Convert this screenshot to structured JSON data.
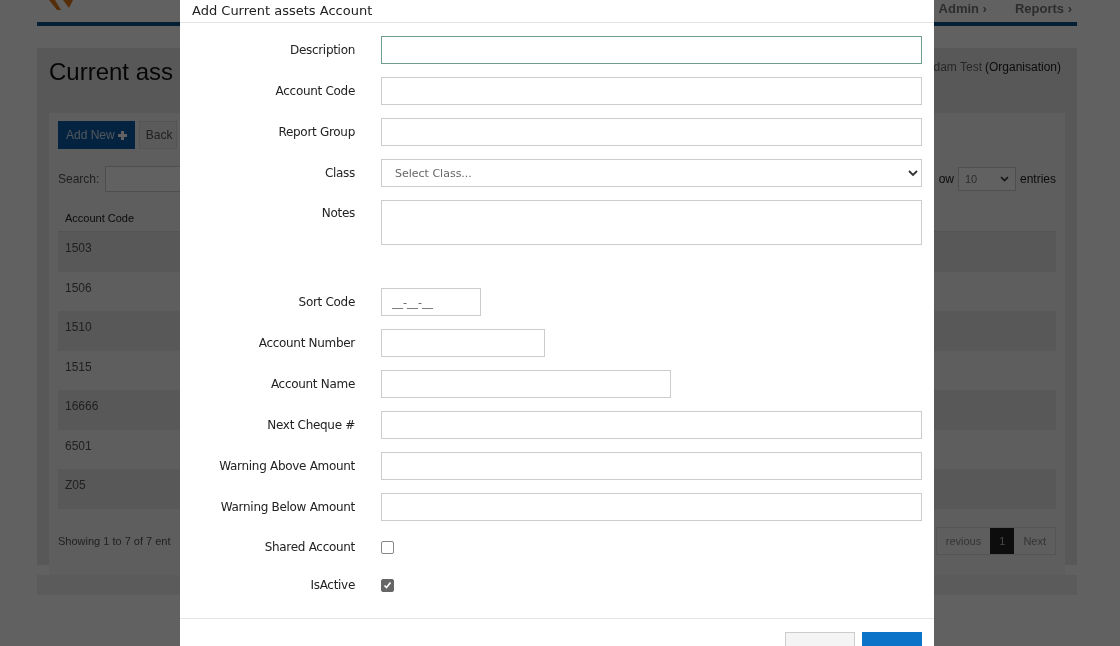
{
  "nav": [
    {
      "label": "Admin ›"
    },
    {
      "label": "Reports ›"
    }
  ],
  "page": {
    "title": "Current ass",
    "user": "dam Test",
    "org": "(Organisation)"
  },
  "toolbar": {
    "add_button": "Add New",
    "back_button": "Back"
  },
  "search": {
    "label": "Search:"
  },
  "length": {
    "label_left": "ow",
    "value": "10",
    "label_right": "entries"
  },
  "table": {
    "columns": [
      "Account Code"
    ],
    "rows": [
      {
        "cells": [
          "1503"
        ]
      },
      {
        "cells": [
          "1506"
        ]
      },
      {
        "cells": [
          "1510"
        ]
      },
      {
        "cells": [
          "1515"
        ]
      },
      {
        "cells": [
          "16666"
        ]
      },
      {
        "cells": [
          "6501"
        ]
      },
      {
        "cells": [
          "Z05"
        ]
      }
    ]
  },
  "info": "Showing 1 to 7 of 7 ent",
  "pagination": [
    {
      "label": "revious",
      "selected": false
    },
    {
      "label": "1",
      "selected": true
    },
    {
      "label": "Next",
      "selected": false
    }
  ],
  "modal": {
    "title": "Add Current assets Account",
    "fields": [
      {
        "label": "Description",
        "kind": "text",
        "focused": true
      },
      {
        "label": "Account Code",
        "kind": "text",
        "focused": false
      },
      {
        "label": "Report Group",
        "kind": "text",
        "focused": false
      },
      {
        "label": "Class",
        "kind": "select",
        "placeholder": "Select Class..."
      },
      {
        "label": "Notes",
        "kind": "textarea"
      },
      {
        "label": "Sort Code",
        "kind": "short",
        "value": "__-__-__",
        "focused": false
      },
      {
        "label": "Account Number",
        "kind": "medium",
        "focused": false
      },
      {
        "label": "Account Name",
        "kind": "long",
        "focused": false
      },
      {
        "label": "Next Cheque #",
        "kind": "text",
        "focused": false
      },
      {
        "label": "Warning Above Amount",
        "kind": "text",
        "focused": false
      },
      {
        "label": "Warning Below Amount",
        "kind": "text",
        "focused": false
      },
      {
        "label": "Shared Account",
        "kind": "checkbox",
        "checked": false
      },
      {
        "label": "IsActive",
        "kind": "checkbox",
        "checked": true
      }
    ]
  }
}
